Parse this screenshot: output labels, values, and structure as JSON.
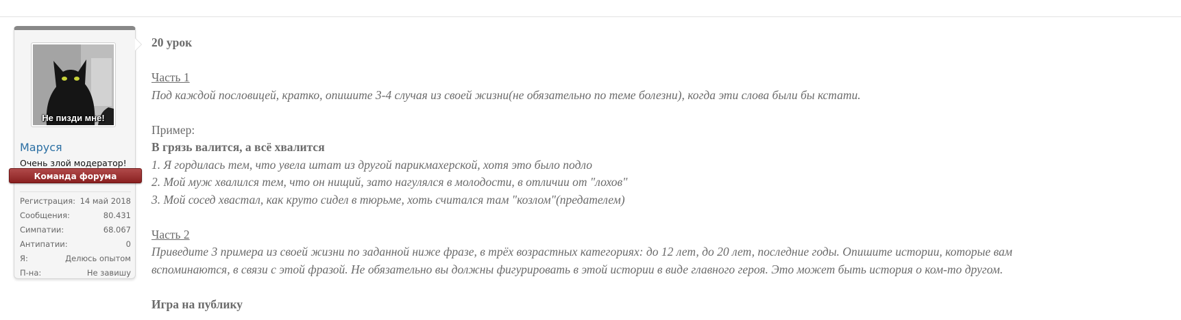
{
  "user": {
    "avatar_caption": "Не пизди мне!",
    "name": "Маруся",
    "title": "Очень злой модератор!",
    "banner": "Команда форума",
    "stats": [
      {
        "label": "Регистрация:",
        "value": "14 май 2018"
      },
      {
        "label": "Сообщения:",
        "value": "80.431"
      },
      {
        "label": "Симпатии:",
        "value": "68.067"
      },
      {
        "label": "Антипатии:",
        "value": "0"
      },
      {
        "label": "Я:",
        "value": "Делюсь опытом"
      },
      {
        "label": "П-на:",
        "value": "Не завишу"
      }
    ]
  },
  "post": {
    "heading": "20 урок",
    "part1_title": "Часть 1",
    "part1_text": "Под каждой пословицей, кратко, опишите 3-4 случая из своей жизни(не обязательно по теме болезни), когда эти слова были бы кстати.",
    "example_label": "Пример:",
    "proverb": "В грязь валится, а всё хвалится",
    "examples": [
      "1. Я гордилась тем, что увела штат из другой парикмахерской, хотя это было подло",
      "2. Мой муж хвалился тем, что он нищий, зато нагулялся в молодости, в отличии от \"лохов\"",
      "3. Мой сосед хвастал, как круто сидел в тюрьме, хоть считался там \"козлом\"(предателем)"
    ],
    "part2_title": "Часть 2",
    "part2_text_line1": "Приведите 3 примера из своей жизни по заданной ниже фразе, в трёх возрастных категориях: до 12 лет, до 20 лет, последние годы. Опишите истории, которые вам",
    "part2_text_line2": "вспоминаются, в связи с этой фразой. Не обязательно вы должны фигурировать в этой истории в виде главного героя. Это может быть история о ком-то другом.",
    "phrase": "Игра на публику"
  }
}
